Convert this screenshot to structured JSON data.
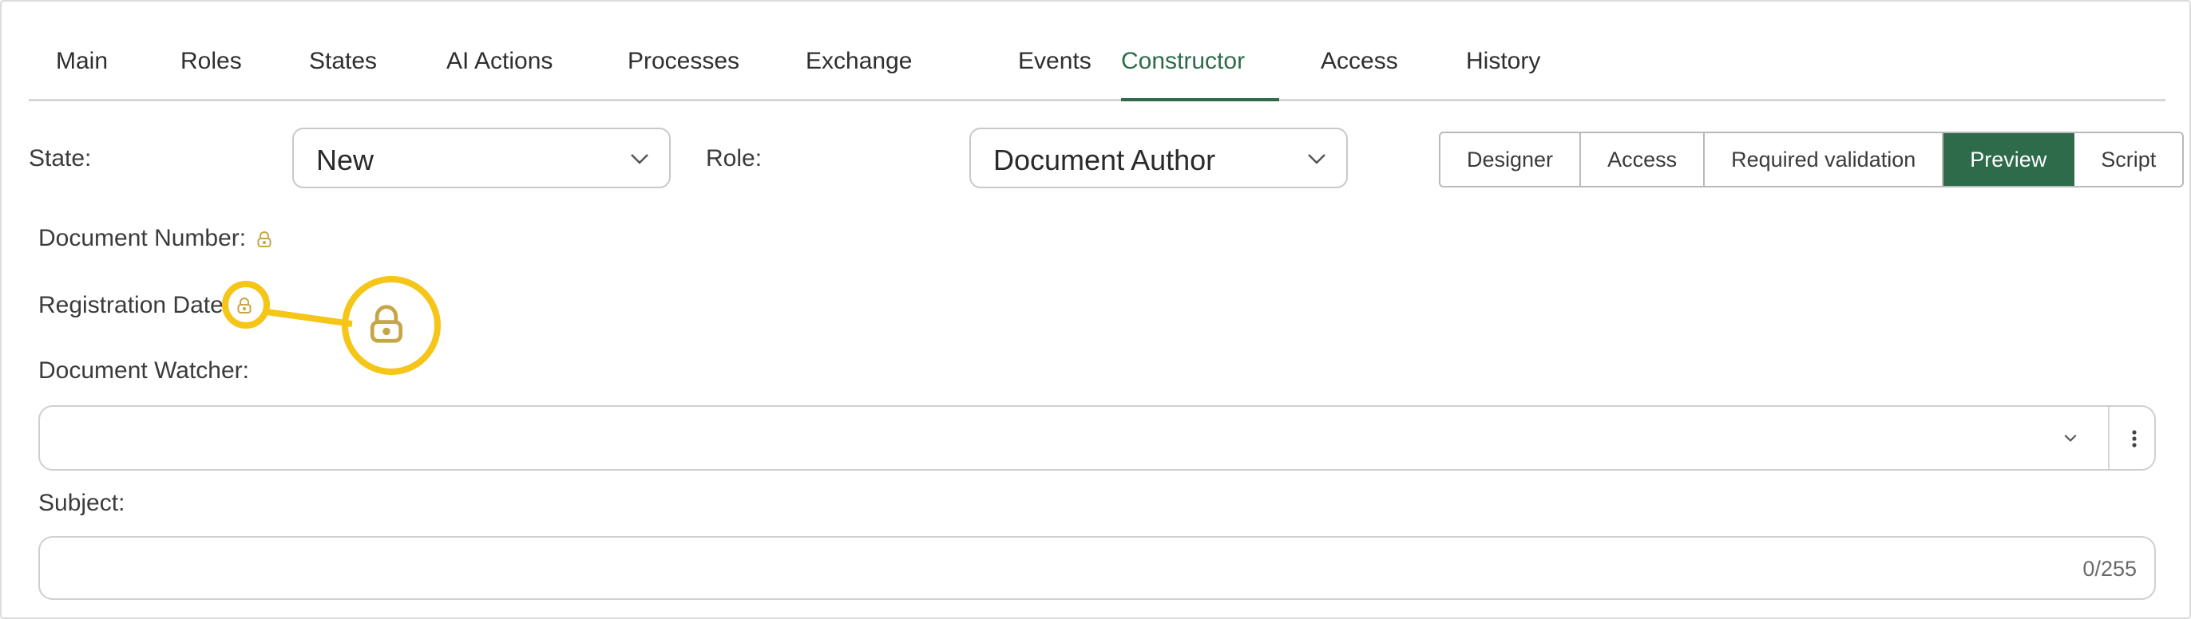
{
  "tabs": [
    {
      "label": "Main"
    },
    {
      "label": "Roles"
    },
    {
      "label": "States"
    },
    {
      "label": "AI Actions"
    },
    {
      "label": "Processes"
    },
    {
      "label": "Exchange"
    },
    {
      "label": "Events"
    },
    {
      "label": "Constructor"
    },
    {
      "label": "Access"
    },
    {
      "label": "History"
    }
  ],
  "active_tab": "Constructor",
  "state": {
    "label": "State:",
    "value": "New"
  },
  "role": {
    "label": "Role:",
    "value": "Document Author"
  },
  "modes": [
    {
      "label": "Designer"
    },
    {
      "label": "Access"
    },
    {
      "label": "Required validation"
    },
    {
      "label": "Preview"
    },
    {
      "label": "Script"
    }
  ],
  "active_mode": "Preview",
  "fields": {
    "document_number": "Document Number:",
    "registration_date": "Registration Date",
    "document_watcher": "Document Watcher:",
    "subject": "Subject:",
    "subject_counter": "0/255"
  },
  "icons": {
    "lock": "lock-icon",
    "chevron": "chevron-down-icon",
    "more": "more-vertical-icon"
  },
  "colors": {
    "accent": "#2e6b4b",
    "lock": "#c4a645",
    "highlight": "#f5c518"
  }
}
